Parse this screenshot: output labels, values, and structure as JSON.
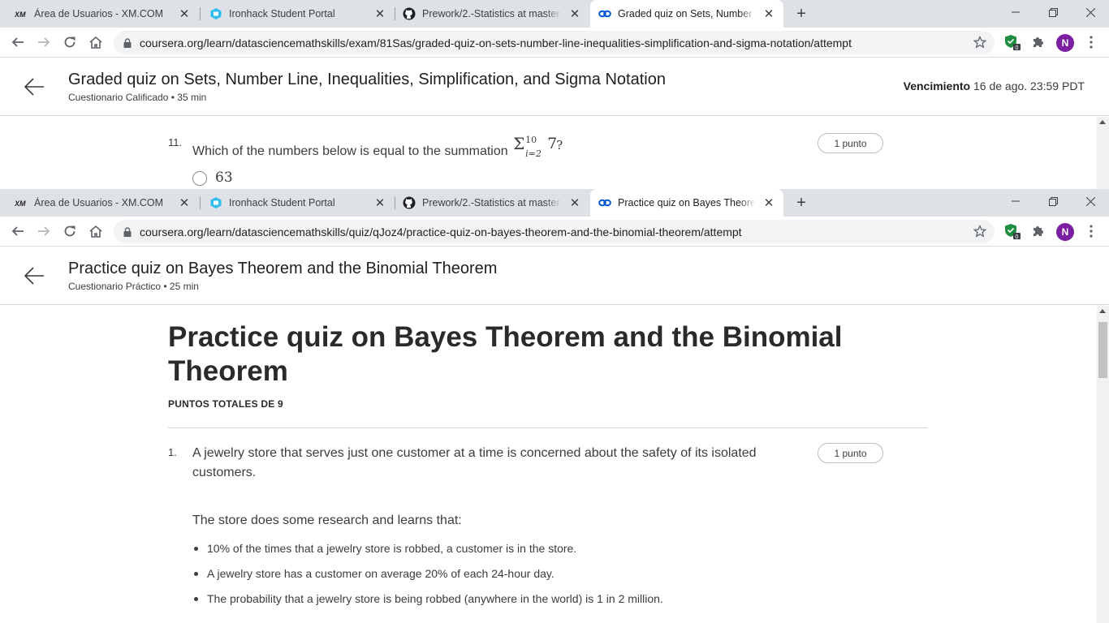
{
  "browser_back": {
    "tabs": [
      {
        "title": "Área de Usuarios - XM.COM",
        "favicon": "xm-logo"
      },
      {
        "title": "Ironhack Student Portal",
        "favicon": "ironhack-logo"
      },
      {
        "title": "Prework/2.-Statistics at master · N",
        "favicon": "github-logo"
      },
      {
        "title": "Graded quiz on Sets, Number Lin",
        "favicon": "coursera-logo"
      }
    ],
    "url": "coursera.org/learn/datasciencemathskills/exam/81Sas/graded-quiz-on-sets-number-line-inequalities-simplification-and-sigma-notation/attempt",
    "extension_badge": "0",
    "profile_initial": "N"
  },
  "graded_page": {
    "title": "Graded quiz on Sets, Number Line, Inequalities, Simplification, and Sigma Notation",
    "subtitle": "Cuestionario Calificado • 35 min",
    "due_label": "Vencimiento",
    "due_value": "16 de ago. 23:59 PDT",
    "question": {
      "number": "11.",
      "text": "Which of the numbers below is equal to the summation",
      "sigma": "Σ",
      "sigma_upper": "10",
      "sigma_lower": "i=2",
      "sigma_term": "7",
      "sigma_end": "?",
      "points": "1 punto",
      "options": [
        "63"
      ]
    }
  },
  "browser_front": {
    "tabs": [
      {
        "title": "Área de Usuarios - XM.COM",
        "favicon": "xm-logo"
      },
      {
        "title": "Ironhack Student Portal",
        "favicon": "ironhack-logo"
      },
      {
        "title": "Prework/2.-Statistics at master · N",
        "favicon": "github-logo"
      },
      {
        "title": "Practice quiz on Bayes Theorem a",
        "favicon": "coursera-logo"
      }
    ],
    "url": "coursera.org/learn/datasciencemathskills/quiz/qJoz4/practice-quiz-on-bayes-theorem-and-the-binomial-theorem/attempt",
    "extension_badge": "0",
    "profile_initial": "N"
  },
  "practice_page": {
    "title": "Practice quiz on Bayes Theorem and the Binomial Theorem",
    "subtitle": "Cuestionario Práctico • 25 min",
    "heading": "Practice quiz on Bayes Theorem and the Binomial Theorem",
    "totals": "PUNTOS TOTALES DE 9",
    "question": {
      "number": "1.",
      "text": "A jewelry store that serves just one customer at a time is concerned about the safety of its isolated customers.",
      "points": "1 punto",
      "research": "The store does some research and learns that:",
      "bullets": [
        "10% of the times that a jewelry store is robbed, a customer is in the store.",
        "A jewelry store has a customer on average 20% of each 24-hour day.",
        "The probability that a jewelry store is being robbed (anywhere in the world) is 1 in 2 million."
      ]
    }
  },
  "colors": {
    "tabstrip_bg": "#dee1e6",
    "avatar_bg": "#7b1fa2",
    "shield_green": "#1e8e3e",
    "coursera_blue": "#0056d2"
  }
}
